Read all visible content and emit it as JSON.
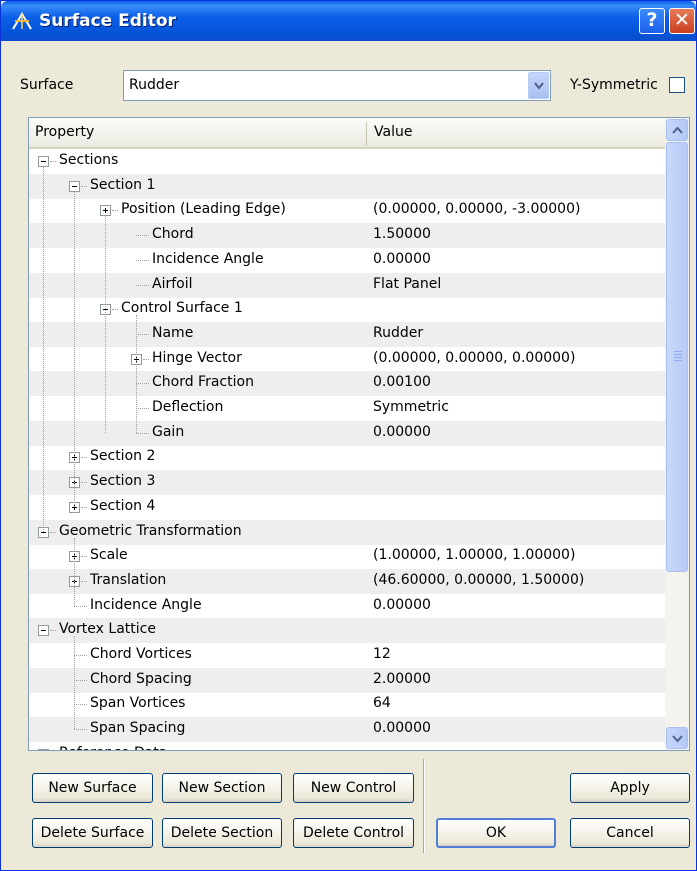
{
  "window": {
    "title": "Surface Editor",
    "help_label": "?",
    "close_label": "✕"
  },
  "surface": {
    "label": "Surface",
    "value": "Rudder",
    "ysym_label": "Y-Symmetric",
    "ysym_checked": false
  },
  "grid": {
    "col_property": "Property",
    "col_value": "Value",
    "rows": [
      {
        "label": "Sections",
        "value": "",
        "expander": "minus"
      },
      {
        "label": "Section 1",
        "value": "",
        "expander": "minus"
      },
      {
        "label": "Position (Leading Edge)",
        "value": "(0.00000, 0.00000, -3.00000)",
        "expander": "plus"
      },
      {
        "label": "Chord",
        "value": "1.50000",
        "expander": ""
      },
      {
        "label": "Incidence Angle",
        "value": "0.00000",
        "expander": ""
      },
      {
        "label": "Airfoil",
        "value": "Flat Panel",
        "expander": ""
      },
      {
        "label": "Control Surface 1",
        "value": "",
        "expander": "minus"
      },
      {
        "label": "Name",
        "value": "Rudder",
        "expander": ""
      },
      {
        "label": "Hinge Vector",
        "value": "(0.00000, 0.00000, 0.00000)",
        "expander": "plus"
      },
      {
        "label": "Chord Fraction",
        "value": "0.00100",
        "expander": ""
      },
      {
        "label": "Deflection",
        "value": "Symmetric",
        "expander": ""
      },
      {
        "label": "Gain",
        "value": "0.00000",
        "expander": ""
      },
      {
        "label": "Section 2",
        "value": "",
        "expander": "plus"
      },
      {
        "label": "Section 3",
        "value": "",
        "expander": "plus"
      },
      {
        "label": "Section 4",
        "value": "",
        "expander": "plus"
      },
      {
        "label": "Geometric Transformation",
        "value": "",
        "expander": "minus"
      },
      {
        "label": "Scale",
        "value": "(1.00000, 1.00000, 1.00000)",
        "expander": "plus"
      },
      {
        "label": "Translation",
        "value": "(46.60000, 0.00000, 1.50000)",
        "expander": "plus"
      },
      {
        "label": "Incidence Angle",
        "value": "0.00000",
        "expander": ""
      },
      {
        "label": "Vortex Lattice",
        "value": "",
        "expander": "minus"
      },
      {
        "label": "Chord Vortices",
        "value": "12",
        "expander": ""
      },
      {
        "label": "Chord Spacing",
        "value": "2.00000",
        "expander": ""
      },
      {
        "label": "Span Vortices",
        "value": "64",
        "expander": ""
      },
      {
        "label": "Span Spacing",
        "value": "0.00000",
        "expander": ""
      },
      {
        "label": "Reference Data",
        "value": "",
        "expander": "minus"
      }
    ]
  },
  "buttons": {
    "new_surface": "New Surface",
    "new_section": "New Section",
    "new_control": "New Control",
    "delete_surface": "Delete Surface",
    "delete_section": "Delete Section",
    "delete_control": "Delete Control",
    "apply": "Apply",
    "ok": "OK",
    "cancel": "Cancel"
  },
  "icons": {
    "app": "surface-editor-app-icon",
    "combo_arrow": "chevron-down-icon",
    "scroll_up": "chevron-up-icon",
    "scroll_down": "chevron-down-icon"
  }
}
